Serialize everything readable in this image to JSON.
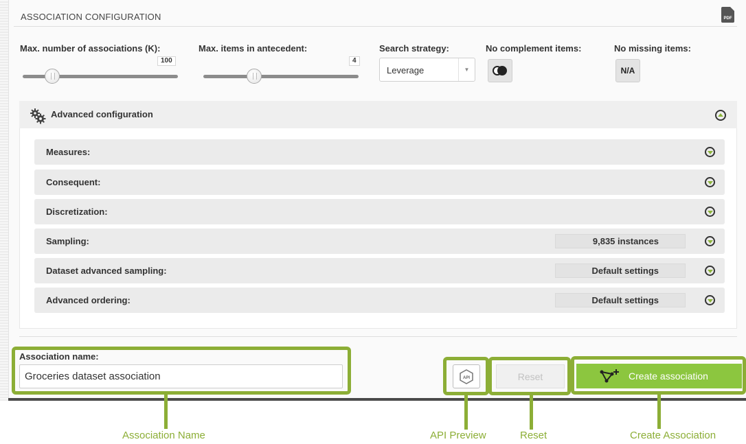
{
  "section": {
    "title": "ASSOCIATION CONFIGURATION",
    "pdf_icon": "pdf-icon",
    "pdf_label": "PDF"
  },
  "params": {
    "max_associations": {
      "label": "Max. number of associations (K):",
      "value": "100"
    },
    "max_antecedent": {
      "label": "Max. items in antecedent:",
      "value": "4"
    },
    "search_strategy": {
      "label": "Search strategy:",
      "selected": "Leverage"
    },
    "no_complement": {
      "label": "No complement items:",
      "icon": "complement-circles-icon"
    },
    "no_missing": {
      "label": "No missing items:",
      "button_text": "N/A"
    }
  },
  "advanced": {
    "title": "Advanced configuration",
    "icon": "gears-icon",
    "rows": [
      {
        "label": "Measures:",
        "value": ""
      },
      {
        "label": "Consequent:",
        "value": ""
      },
      {
        "label": "Discretization:",
        "value": ""
      },
      {
        "label": "Sampling:",
        "value": "9,835 instances"
      },
      {
        "label": "Dataset advanced sampling:",
        "value": "Default settings"
      },
      {
        "label": "Advanced ordering:",
        "value": "Default settings"
      }
    ]
  },
  "form": {
    "name_label": "Association name:",
    "name_value": "Groceries dataset association",
    "api_icon": "api-icon",
    "api_text": "API",
    "reset_label": "Reset",
    "create_label": "Create association",
    "create_icon": "association-plus-icon"
  },
  "callouts": {
    "name": "Association Name",
    "api": "API Preview",
    "reset": "Reset",
    "create": "Create Association"
  },
  "colors": {
    "highlight": "#8cae36",
    "create_button": "#8cc63f",
    "accent_arrow": "#8cb43a"
  }
}
